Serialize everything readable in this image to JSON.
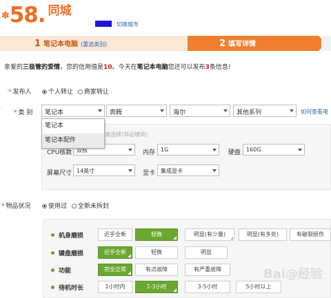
{
  "header": {
    "logo_mark": "✽",
    "logo_number": "58.",
    "logo_text": "同城",
    "city_switch": "切换城市"
  },
  "steps": {
    "step1_num": "1",
    "step1_label": "笔记本电脑",
    "step1_sub": "(重选类别)",
    "step2_num": "2",
    "step2_label": "填写详情"
  },
  "notice": {
    "prefix": "亲爱的",
    "level": "三极管的爱情",
    "mid": "，您的信用值是",
    "credit": "10",
    "mid2": "。今天在",
    "category": "笔记本电脑",
    "mid3": "您还可以发布",
    "count": "3",
    "suffix": "条信息!"
  },
  "publisher": {
    "label": "发布人",
    "options": [
      "个人转让",
      "商家转让"
    ],
    "selected": 0
  },
  "category": {
    "label": "类  别",
    "selects": [
      "笔记本",
      "奔腾",
      "海尔",
      "其他系列"
    ],
    "help_link": "如何查看电",
    "dropdown_items": [
      "笔记本",
      "笔记本配件"
    ],
    "hint": "请选择(非必填项)"
  },
  "specs": {
    "cpu_label": "CPU核数",
    "cpu_value": "双核",
    "memory_label": "内存",
    "memory_value": "1G",
    "disk_label": "硬盘",
    "disk_value": "160G",
    "screen_label": "屏幕尺寸",
    "screen_value": "14英寸",
    "gpu_label": "显卡",
    "gpu_value": "集成显卡"
  },
  "condition": {
    "label": "物品状况",
    "options": [
      "使用过",
      "全新未拆封"
    ],
    "selected": 0,
    "rows": [
      {
        "label": "机身磨损",
        "chips": [
          "近乎全新",
          "轻微",
          "明显(有少量)",
          "明显(有多处)",
          "有破裂损伤"
        ],
        "selected": 1
      },
      {
        "label": "键盘磨损",
        "chips": [
          "近乎全新",
          "轻微",
          "明显"
        ],
        "selected": 0
      },
      {
        "label": "功能",
        "chips": [
          "完全正常",
          "有点故障",
          "有严重故障"
        ],
        "selected": 0
      },
      {
        "label": "待机时长",
        "chips": [
          "1小时内",
          "1-3小时",
          "3-5小时",
          "5小时以上"
        ],
        "selected": 1
      }
    ]
  },
  "watermark": "Bai@经验",
  "colors": {
    "brand": "#f26b21",
    "step_active": "#ef7f2f",
    "chip_selected": "#6aa82f",
    "link": "#3366aa"
  }
}
